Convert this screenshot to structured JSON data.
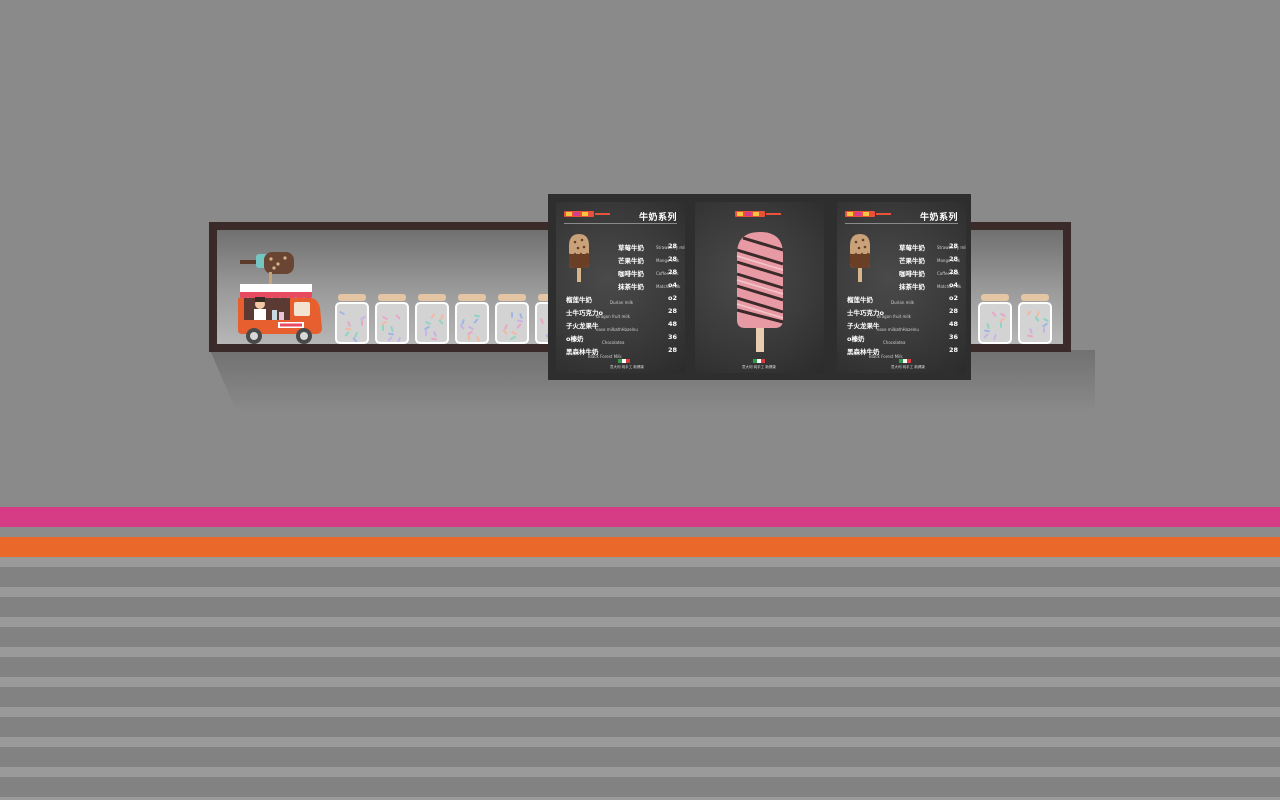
{
  "colors": {
    "wall": "#8a8a8a",
    "pink_stripe": "#d63c86",
    "orange_stripe": "#e9682a",
    "shelf_frame": "#3a2a2a",
    "board": "#2e2e2e",
    "truck_orange": "#e85f2f"
  },
  "menu_panels": [
    {
      "type": "menu",
      "title": "牛奶系列",
      "items": [
        {
          "name": "草莓牛奶",
          "en": "Strawberry milk",
          "price": "28"
        },
        {
          "name": "芒果牛奶",
          "en": "Mango milk",
          "price": "28"
        },
        {
          "name": "咖啡牛奶",
          "en": "Coffee milk",
          "price": "28"
        },
        {
          "name": "抹茶牛奶",
          "en": "Matcha milk",
          "price": "o4"
        },
        {
          "name": "榴莲牛奶",
          "en": "Durian milk",
          "price": "o2"
        },
        {
          "name": "士牛巧克力o",
          "en": "Dragon fruit milk",
          "price": "28"
        },
        {
          "name": "子火龙果牛",
          "en": "ease milkathHazelnu",
          "price": "48"
        },
        {
          "name": "o榛奶",
          "en": "Chocolatea",
          "price": "36"
        },
        {
          "name": "黑森林牛奶",
          "en": "Black Forest Milk",
          "price": "28"
        }
      ],
      "footer": "意大利 纯手工 新健康"
    },
    {
      "type": "photo",
      "footer": "意大利 纯手工 新健康"
    },
    {
      "type": "menu",
      "title": "牛奶系列",
      "items": [
        {
          "name": "草莓牛奶",
          "en": "Strawberry milk",
          "price": "28"
        },
        {
          "name": "芒果牛奶",
          "en": "Mango milk",
          "price": "28"
        },
        {
          "name": "咖啡牛奶",
          "en": "Coffee milk",
          "price": "28"
        },
        {
          "name": "抹茶牛奶",
          "en": "Matcha milk",
          "price": "o4"
        },
        {
          "name": "榴莲牛奶",
          "en": "Durian milk",
          "price": "o2"
        },
        {
          "name": "士牛巧克力o",
          "en": "Dragon fruit milk",
          "price": "28"
        },
        {
          "name": "子火龙果牛",
          "en": "ease milkathHazelnu",
          "price": "48"
        },
        {
          "name": "o榛奶",
          "en": "Chocolatea",
          "price": "36"
        },
        {
          "name": "黑森林牛奶",
          "en": "Black Forest Milk",
          "price": "28"
        }
      ],
      "footer": "意大利 纯手工 新健康"
    }
  ]
}
